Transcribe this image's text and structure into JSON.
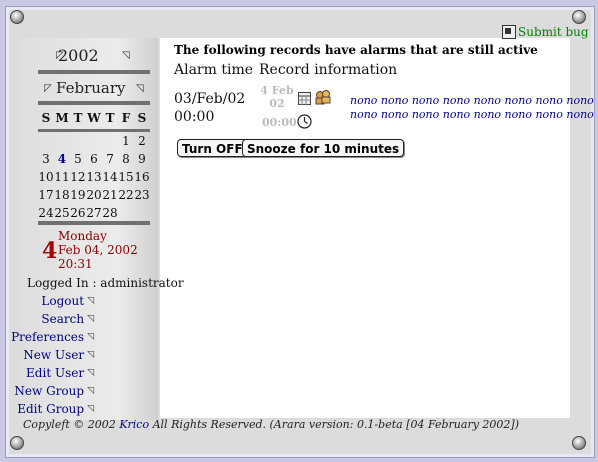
{
  "header": {
    "submit_bug": "Submit bug"
  },
  "calendar": {
    "year": "2002",
    "month": "February",
    "weekdays": [
      "S",
      "M",
      "T",
      "W",
      "T",
      "F",
      "S"
    ],
    "weeks": [
      [
        "",
        "",
        "",
        "",
        "",
        "1",
        "2"
      ],
      [
        "3",
        "4",
        "5",
        "6",
        "7",
        "8",
        "9"
      ],
      [
        "10",
        "11",
        "12",
        "13",
        "14",
        "15",
        "16"
      ],
      [
        "17",
        "18",
        "19",
        "20",
        "21",
        "22",
        "23"
      ],
      [
        "24",
        "25",
        "26",
        "27",
        "28",
        "",
        ""
      ]
    ],
    "today_day": "4"
  },
  "today": {
    "big_day": "4",
    "weekday": "Monday",
    "date": "Feb 04, 2002",
    "time": "20:31"
  },
  "session": {
    "logged_in": "Logged In : administrator"
  },
  "nav": [
    "Logout",
    "Search",
    "Preferences",
    "New User",
    "Edit User",
    "New Group",
    "Edit Group"
  ],
  "main": {
    "heading": "The following records have alarms that are still active",
    "col_alarm": "Alarm time",
    "col_record": "Record information",
    "alarm_date": "03/Feb/02",
    "alarm_time": "00:00",
    "rec_date_1": "4 Feb",
    "rec_date_2": "02",
    "rec_time": "00:00",
    "info_line_1": "nono nono nono nono nono nono nono nono",
    "info_line_2": "nono nono nono nono nono nono nono nono",
    "turn_off": "Turn OFF",
    "snooze": "Snooze for 10 minutes"
  },
  "footer": {
    "prefix": "Copyleft © 2002 ",
    "brand": "Krico",
    "suffix": " All Rights Reserved. (Arara version: 0.1-beta [04 February 2002])"
  }
}
